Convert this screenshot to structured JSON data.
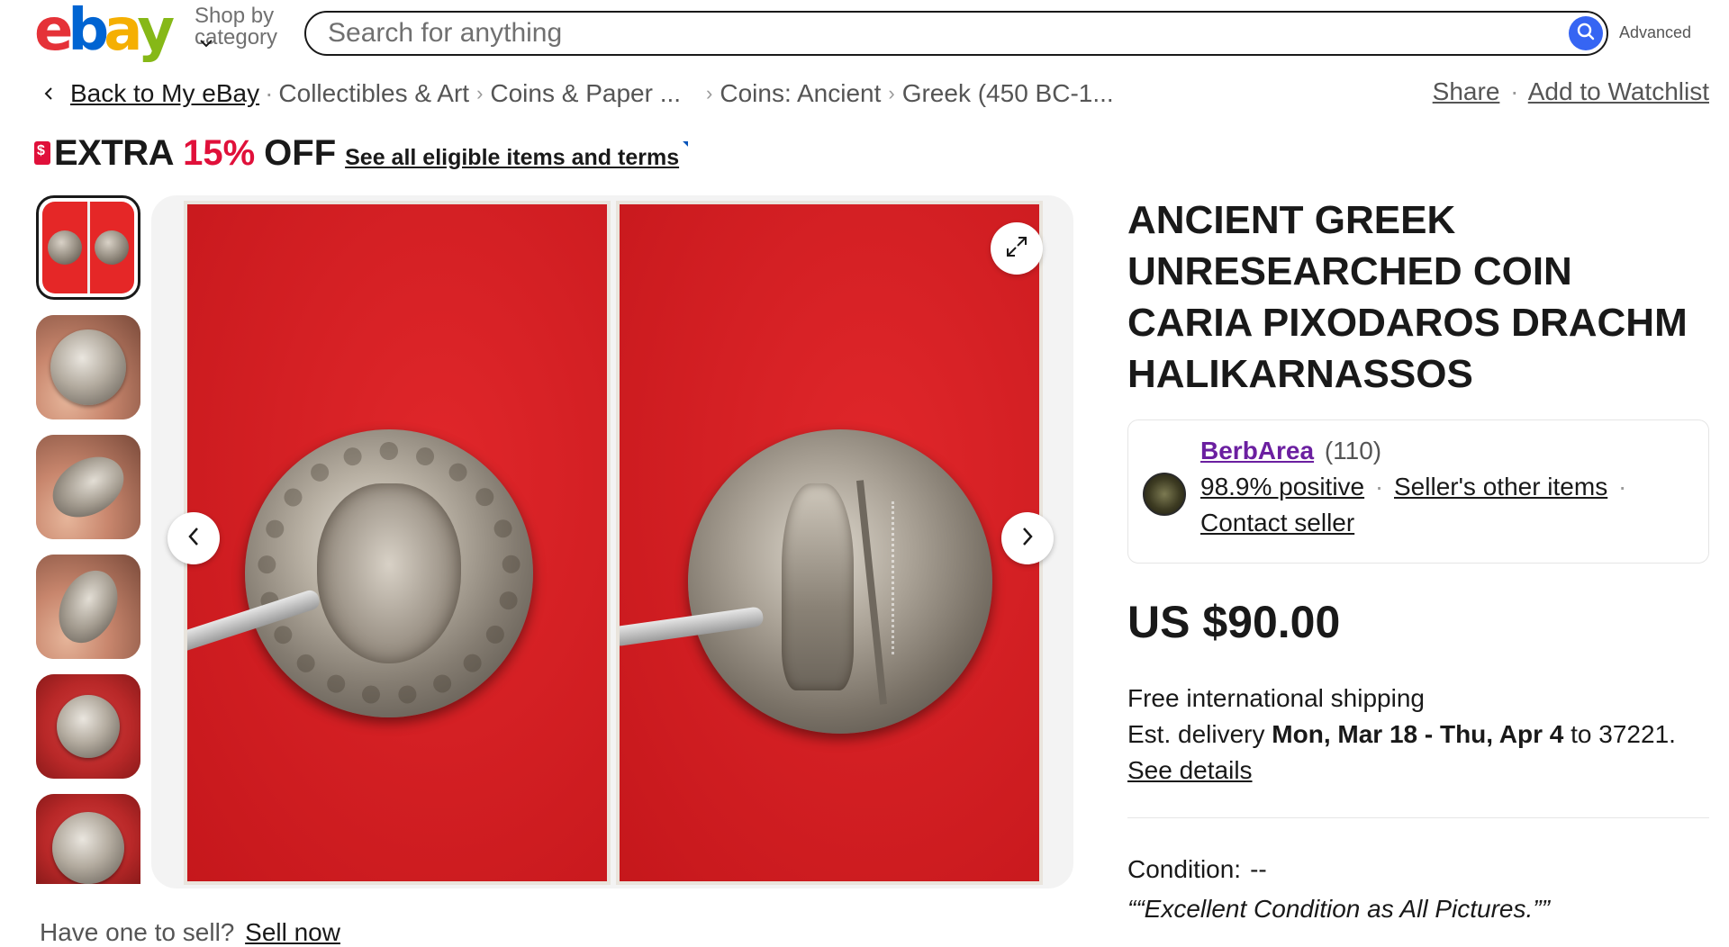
{
  "header": {
    "logo_letters": [
      "e",
      "b",
      "a",
      "y"
    ],
    "logo_colors": [
      "#e53238",
      "#0064d2",
      "#f5af02",
      "#86b817"
    ],
    "shop_by_line1": "Shop by",
    "shop_by_line2": "category",
    "search_placeholder": "Search for anything",
    "search_value": "",
    "search_icon": "search-icon",
    "advanced_label": "Advanced"
  },
  "breadcrumb": {
    "back_label": "Back to My eBay",
    "items": [
      "Collectibles & Art",
      "Coins & Paper ...",
      "Coins: Ancient",
      "Greek (450 BC-1..."
    ],
    "share_label": "Share",
    "watchlist_label": "Add to Watchlist"
  },
  "promo": {
    "extra": "EXTRA",
    "percent": "15%",
    "off": "OFF",
    "terms_link": "See all eligible items and terms",
    "accent_color": "#e0103a"
  },
  "gallery": {
    "thumbnail_count": 6,
    "selected_index": 0,
    "prev_icon": "chevron-left-icon",
    "next_icon": "chevron-right-icon",
    "expand_icon": "expand-icon"
  },
  "sell": {
    "prompt": "Have one to sell?",
    "link": "Sell now"
  },
  "item": {
    "title": "ANCIENT GREEK UNRESEARCHED COIN CARIA PIXODAROS DRACHM HALIKARNASSOS",
    "price": "US $90.00"
  },
  "seller": {
    "name": "BerbArea",
    "feedback_count": "(110)",
    "positive": "98.9% positive",
    "other_items": "Seller's other items",
    "contact": "Contact seller",
    "name_color": "#6b1fa0"
  },
  "shipping": {
    "line1": "Free international shipping",
    "est_prefix": "Est. delivery",
    "est_dates": "Mon, Mar 18 - Thu, Apr 4",
    "est_suffix": "to 37221.",
    "details_link": "See details"
  },
  "condition": {
    "label": "Condition:",
    "value": "--",
    "quote": "““Excellent Condition as All Pictures.””"
  }
}
